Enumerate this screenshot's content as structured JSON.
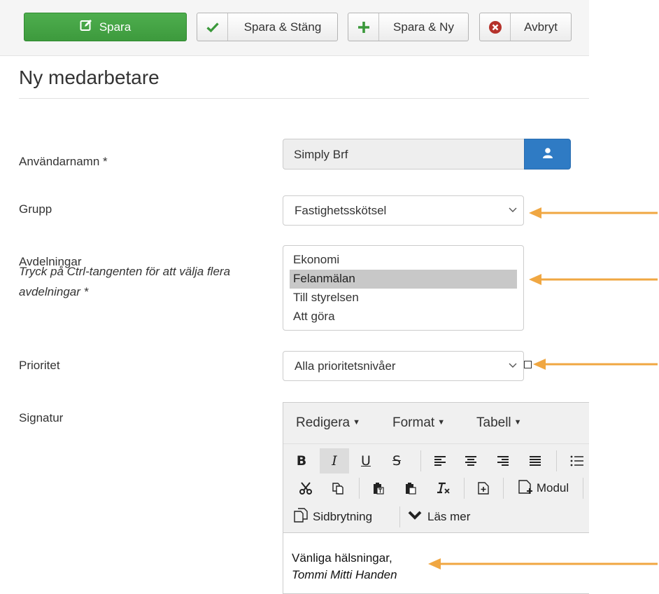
{
  "toolbar": {
    "save_label": "Spara",
    "save_close_label": "Spara & Stäng",
    "save_new_label": "Spara & Ny",
    "cancel_label": "Avbryt"
  },
  "page": {
    "title": "Ny medarbetare"
  },
  "form": {
    "username": {
      "label": "Användarnamn *",
      "value": "Simply Brf"
    },
    "group": {
      "label": "Grupp",
      "selected": "Fastighetsskötsel"
    },
    "departments": {
      "label": "Avdelningar",
      "hint": "Tryck på Ctrl-tangenten för att välja flera avdelningar *",
      "options": [
        "Ekonomi",
        "Felanmälan",
        "Till styrelsen",
        "Att göra"
      ],
      "selected": "Felanmälan"
    },
    "priority": {
      "label": "Prioritet",
      "selected": "Alla prioritetsnivåer"
    },
    "signature": {
      "label": "Signatur",
      "menus": [
        "Redigera",
        "Format",
        "Tabell"
      ],
      "module_label": "Modul",
      "pagebreak_label": "Sidbrytning",
      "readmore_label": "Läs mer",
      "content_line1": "Vänliga hälsningar,",
      "content_line2": "Tommi Mitti Handen"
    }
  },
  "colors": {
    "save_green": "#45a545",
    "accent_blue": "#2f7bc4",
    "annotation_orange": "#f0a742",
    "cancel_red": "#b5322b",
    "check_green": "#3a983a"
  }
}
